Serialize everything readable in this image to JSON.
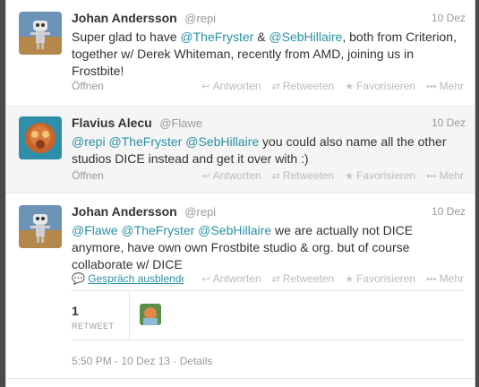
{
  "tweets": [
    {
      "fullname": "Johan Andersson",
      "username": "@repi",
      "time": "10 Dez",
      "text": [
        {
          "t": "Super glad to have ",
          "link": false
        },
        {
          "t": "@TheFryster",
          "link": true
        },
        {
          "t": " & ",
          "link": false
        },
        {
          "t": "@SebHillaire",
          "link": true
        },
        {
          "t": ", both from Criterion, together w/ Derek Whiteman, recently from AMD, joining us in Frostbite!",
          "link": false
        }
      ],
      "open_label": "Öffnen"
    },
    {
      "fullname": "Flavius Alecu",
      "username": "@Flawe",
      "time": "10 Dez",
      "text": [
        {
          "t": "@repi",
          "link": true
        },
        {
          "t": " ",
          "link": false
        },
        {
          "t": "@TheFryster",
          "link": true
        },
        {
          "t": " ",
          "link": false
        },
        {
          "t": "@SebHillaire",
          "link": true
        },
        {
          "t": " you could also name all the other studios DICE instead and get it over with :)",
          "link": false
        }
      ],
      "open_label": "Öffnen"
    },
    {
      "fullname": "Johan Andersson",
      "username": "@repi",
      "time": "10 Dez",
      "text": [
        {
          "t": "@Flawe",
          "link": true
        },
        {
          "t": " ",
          "link": false
        },
        {
          "t": "@TheFryster",
          "link": true
        },
        {
          "t": " ",
          "link": false
        },
        {
          "t": "@SebHillaire",
          "link": true
        },
        {
          "t": " we are actually not DICE anymore, have own own Frostbite studio & org. but of course collaborate w/ DICE",
          "link": false
        }
      ],
      "conversation_label": "Gespräch ausblenden",
      "retweet_count": "1",
      "retweet_label": "RETWEET",
      "timestamp": "5:50 PM - 10 Dez 13",
      "details_label": "Details"
    }
  ],
  "actions": {
    "reply": "Antworten",
    "retweet": "Retweeten",
    "favorite": "Favorisieren",
    "more": "Mehr"
  },
  "icons": {
    "reply": "reply-arrow-icon",
    "retweet": "retweet-icon",
    "favorite": "star-icon",
    "more": "ellipsis-icon",
    "conversation": "speech-bubble-icon"
  },
  "colors": {
    "link": "#2a8fa3",
    "muted": "#999999",
    "text": "#333333"
  }
}
